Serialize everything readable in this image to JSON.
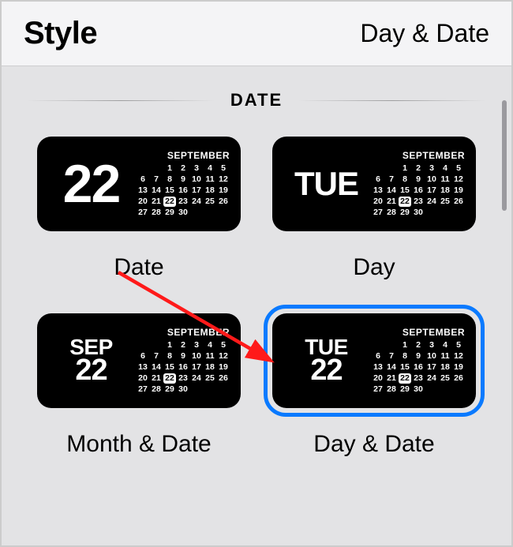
{
  "header": {
    "title": "Style",
    "value": "Day & Date"
  },
  "section": {
    "title": "DATE"
  },
  "month_label": "SEPTEMBER",
  "calendar": {
    "offset": 2,
    "days_in_month": 30,
    "today": 22
  },
  "options": [
    {
      "id": "date",
      "label": "Date",
      "kind": "num",
      "big": "22",
      "selected": false
    },
    {
      "id": "day",
      "label": "Day",
      "kind": "day",
      "big": "TUE",
      "selected": false
    },
    {
      "id": "month-date",
      "label": "Month & Date",
      "kind": "monthdate",
      "top": "SEP",
      "bottom": "22",
      "selected": false
    },
    {
      "id": "day-date",
      "label": "Day & Date",
      "kind": "daydate",
      "top": "TUE",
      "bottom": "22",
      "selected": true
    }
  ]
}
